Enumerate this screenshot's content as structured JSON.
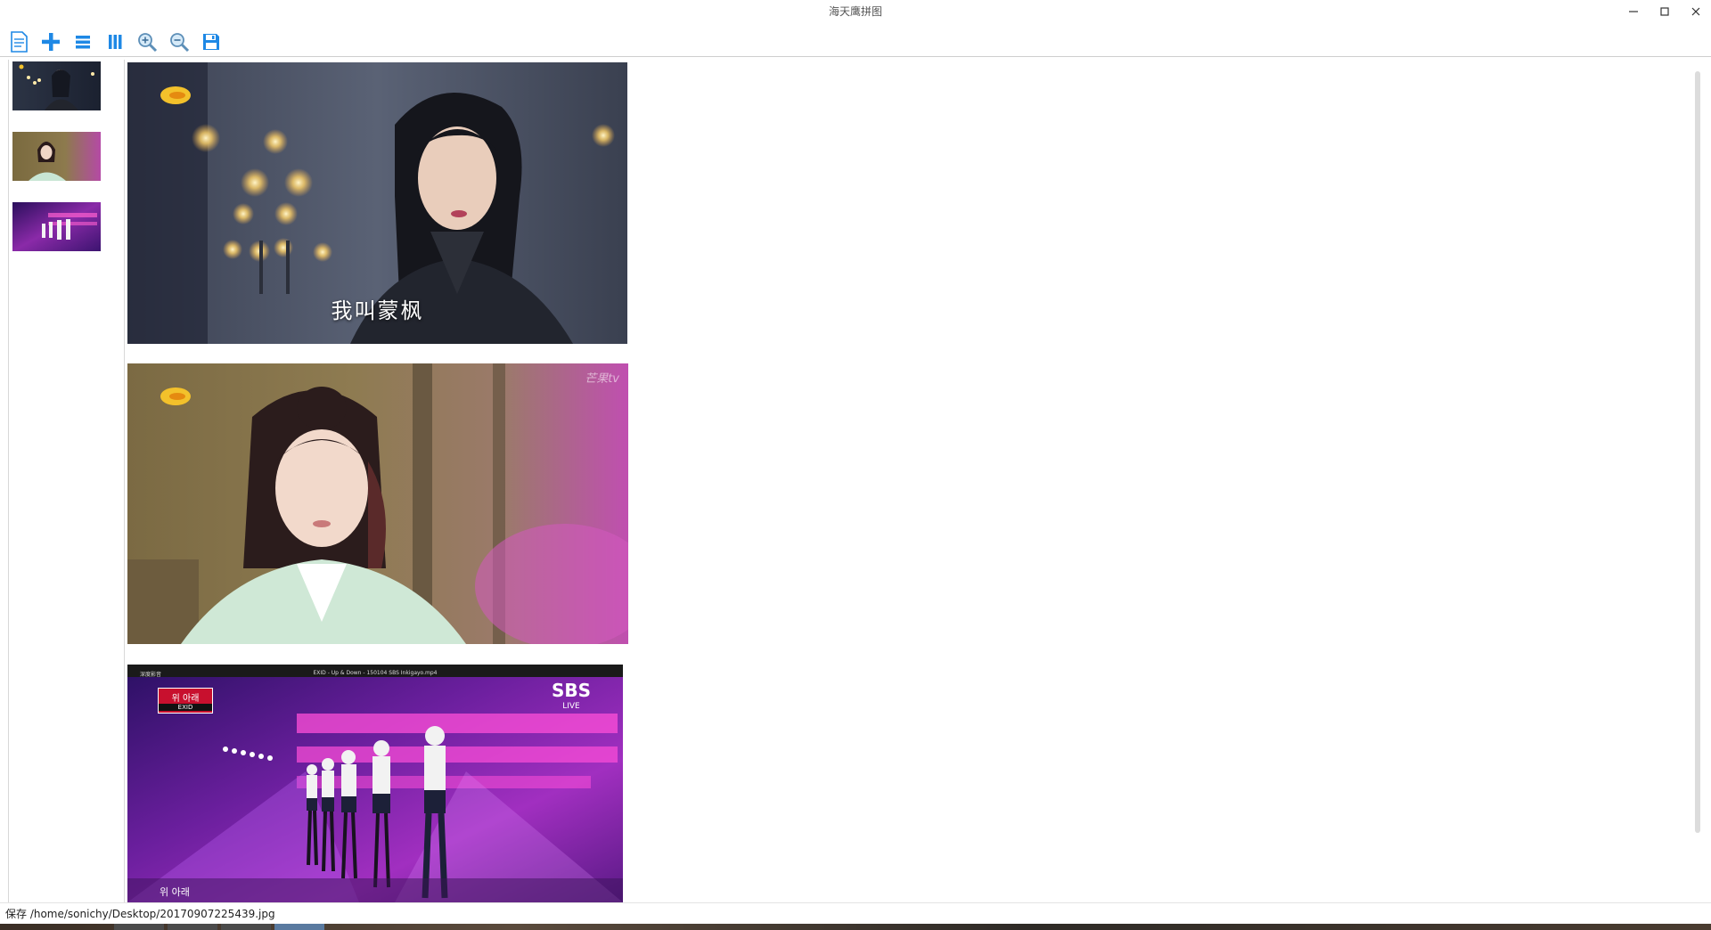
{
  "window": {
    "title": "海天鹰拼图",
    "controls": [
      "minimize",
      "maximize",
      "close"
    ]
  },
  "toolbar": {
    "buttons": [
      {
        "name": "new",
        "icon": "document-icon"
      },
      {
        "name": "add",
        "icon": "plus-icon"
      },
      {
        "name": "vertical-layout",
        "icon": "rows-icon"
      },
      {
        "name": "horizontal-layout",
        "icon": "columns-icon"
      },
      {
        "name": "zoom-in",
        "icon": "zoom-in-icon"
      },
      {
        "name": "zoom-out",
        "icon": "zoom-out-icon"
      },
      {
        "name": "save",
        "icon": "save-icon"
      }
    ],
    "accent": "#1e88e5"
  },
  "thumbnails": [
    {
      "subject": "woman in dark robe, candles"
    },
    {
      "subject": "woman with hair bun, green robe"
    },
    {
      "subject": "stage performance, purple lights"
    }
  ],
  "images": [
    {
      "caption": "我叫蒙枫"
    },
    {
      "watermark": "芒果tv"
    },
    {
      "logo": "SBS",
      "logo_sub": "LIVE",
      "player_app": "深度影音",
      "player_title": "EXID - Up & Down - 150104 SBS Inkigayo.mp4",
      "badge_top": "위 아래",
      "badge_bottom": "EXID",
      "subtitle": "위 아래"
    }
  ],
  "status": {
    "text": "保存 /home/sonichy/Desktop/20170907225439.jpg"
  }
}
